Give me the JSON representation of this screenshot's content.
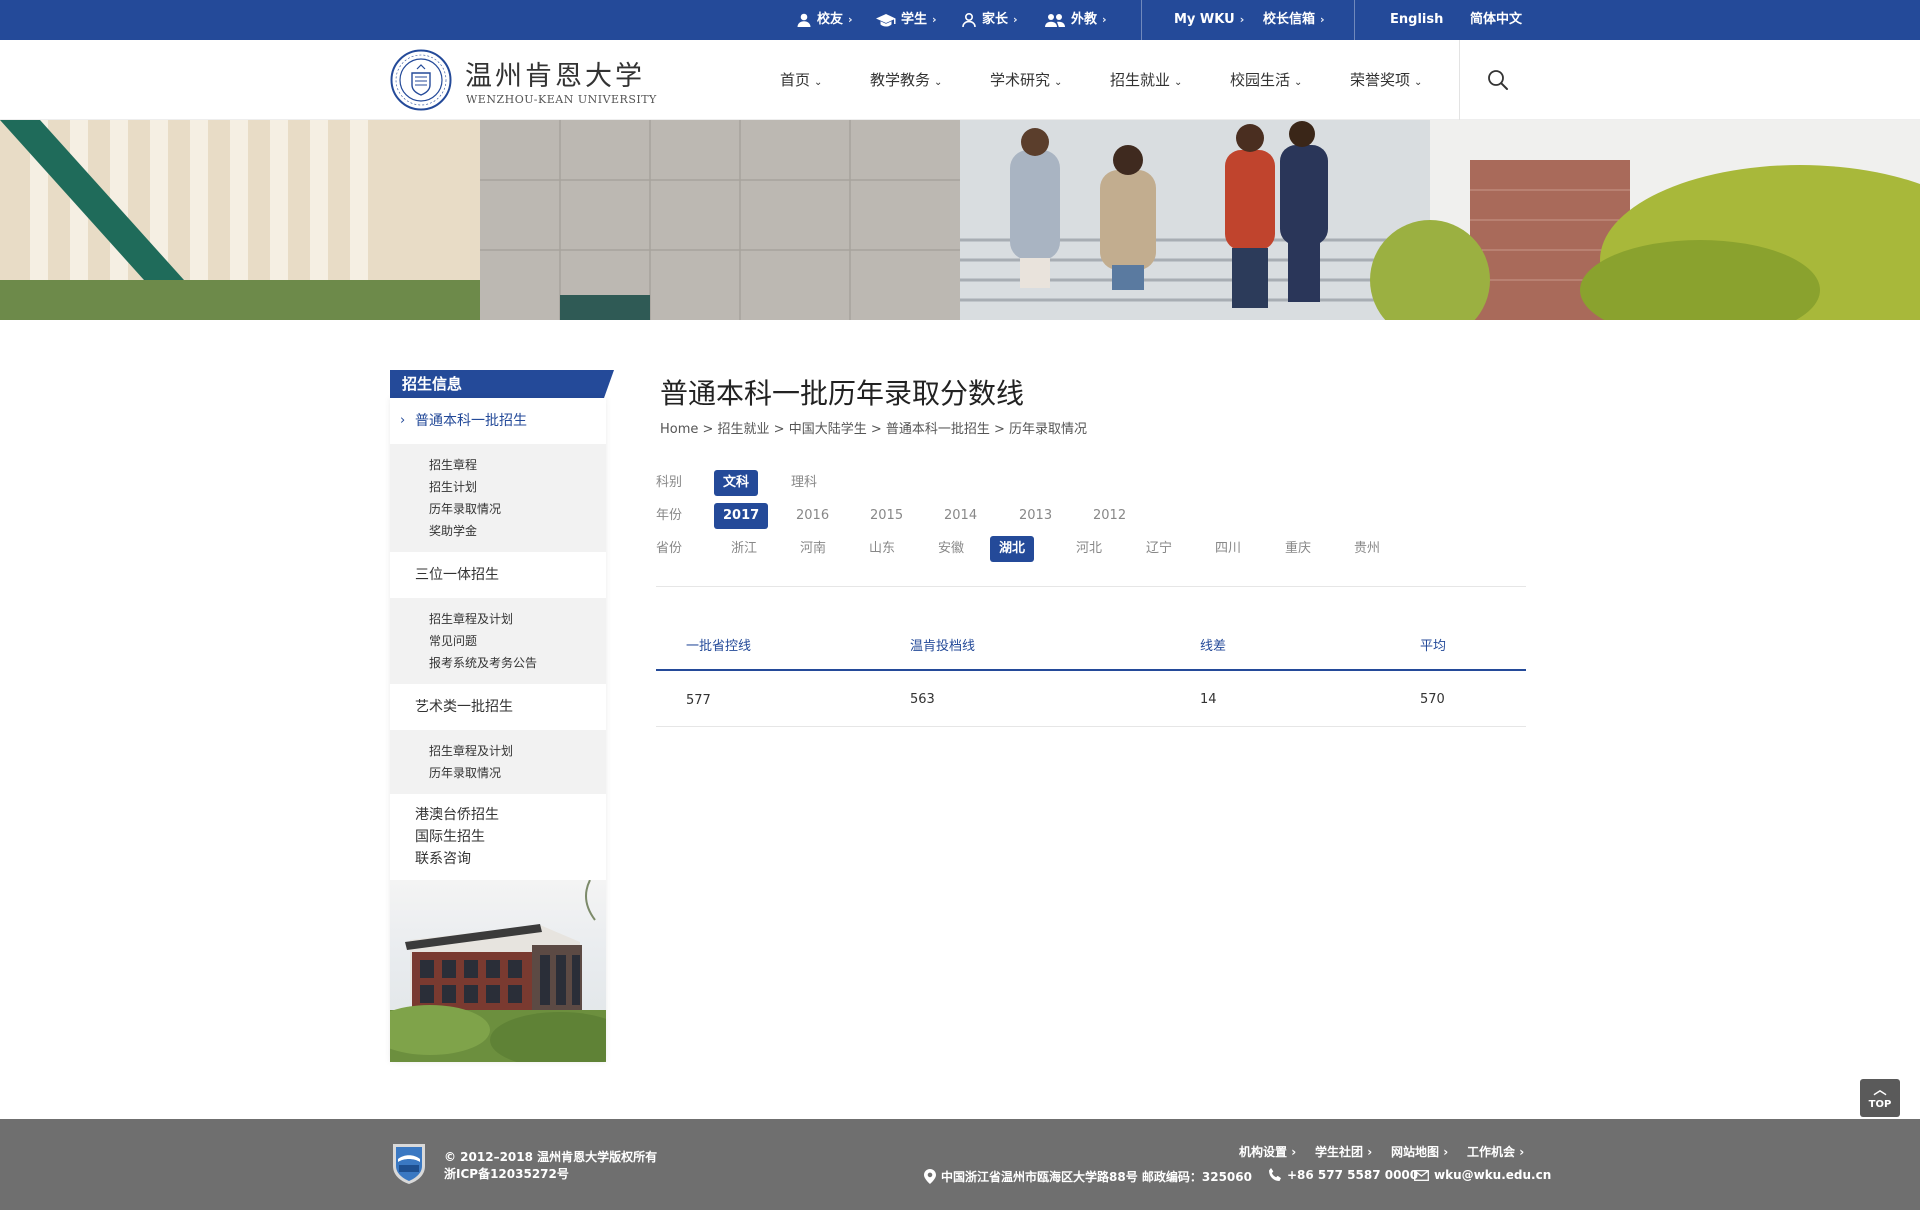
{
  "topbar": {
    "alumni": "校友",
    "students": "学生",
    "parents": "家长",
    "foreigners": "外教",
    "mywku": "My WKU",
    "president_mailbox": "校长信箱",
    "english": "English",
    "chinese": "简体中文"
  },
  "brand": {
    "name_cn": "温州肯恩大学",
    "name_en": "WENZHOU-KEAN UNIVERSITY"
  },
  "nav": [
    "首页",
    "教学教务",
    "学术研究",
    "招生就业",
    "校园生活",
    "荣誉奖项"
  ],
  "sidebar": {
    "header": "招生信息",
    "sections": [
      {
        "label": "普通本科一批招生",
        "items": [
          "招生章程",
          "招生计划",
          "历年录取情况",
          "奖助学金"
        ]
      },
      {
        "label": "三位一体招生",
        "items": [
          "招生章程及计划",
          "常见问题",
          "报考系统及考务公告"
        ]
      },
      {
        "label": "艺术类一批招生",
        "items": [
          "招生章程及计划",
          "历年录取情况"
        ]
      }
    ],
    "plain": [
      "港澳台侨招生",
      "国际生招生",
      "联系咨询"
    ]
  },
  "page": {
    "title": "普通本科一批历年录取分数线",
    "breadcrumb": "Home > 招生就业 > 中国大陆学生 > 普通本科一批招生 > 历年录取情况"
  },
  "filters": {
    "subject_label": "科别",
    "subjects": [
      "文科",
      "理科"
    ],
    "year_label": "年份",
    "years": [
      "2017",
      "2016",
      "2015",
      "2014",
      "2013",
      "2012"
    ],
    "province_label": "省份",
    "provinces": [
      "浙江",
      "河南",
      "山东",
      "安徽",
      "湖北",
      "河北",
      "辽宁",
      "四川",
      "重庆",
      "贵州"
    ],
    "selected_subject": "文科",
    "selected_year": "2017",
    "selected_province": "湖北"
  },
  "table": {
    "headers": [
      "一批省控线",
      "温肯投档线",
      "线差",
      "平均"
    ],
    "rows": [
      [
        "577",
        "563",
        "14",
        "570"
      ]
    ]
  },
  "top_button": "TOP",
  "footer": {
    "copyright": "© 2012–2018 温州肯恩大学版权所有",
    "icp": "浙ICP备12035272号",
    "links": [
      "机构设置",
      "学生社团",
      "网站地图",
      "工作机会"
    ],
    "address": "中国浙江省温州市瓯海区大学路88号 邮政编码：325060",
    "phone": "+86 577 5587 0000",
    "email": "wku@wku.edu.cn"
  },
  "colors": {
    "primary": "#244a99",
    "footer": "#6f6f6f"
  }
}
